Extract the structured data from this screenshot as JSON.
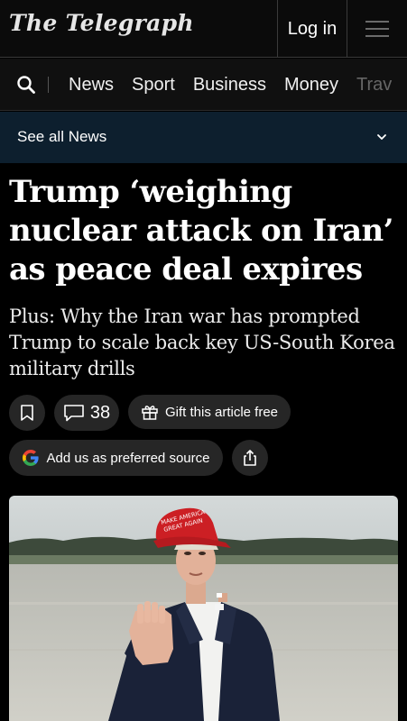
{
  "header": {
    "logo_text": "The Telegraph",
    "login_label": "Log in",
    "menu_icon": "hamburger-menu-icon"
  },
  "nav": {
    "search_icon": "search-icon",
    "items": [
      "News",
      "Sport",
      "Business",
      "Money",
      "Trav"
    ]
  },
  "section_bar": {
    "label": "See all News",
    "icon": "chevron-down-icon",
    "background": "#0d1f2e"
  },
  "article": {
    "headline": "Trump ‘weighing nuclear attack on Iran’ as peace deal expires",
    "subheadline": "Plus: Why the Iran war has prompted Trump to scale back key US-South Korea military drills",
    "comment_count": "38",
    "gift_label": "Gift this article free",
    "preferred_source_label": "Add us as preferred source",
    "hat_text": "MAKE AMERICA GREAT AGAIN"
  },
  "colors": {
    "background": "#000000",
    "pill": "#262626",
    "google_blue": "#4285F4",
    "google_red": "#EA4335",
    "google_yellow": "#FBBC05",
    "google_green": "#34A853"
  }
}
